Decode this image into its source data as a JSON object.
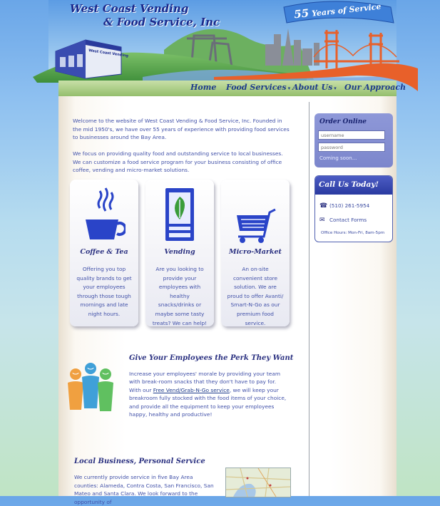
{
  "header": {
    "logo_line1": "West Coast Vending",
    "logo_line2": "& Food Service, Inc",
    "ribbon_number": "55",
    "ribbon_text": "Years of Service",
    "building_sign": "West Coast Vending"
  },
  "nav": {
    "items": [
      {
        "label": "Home",
        "dropdown": false
      },
      {
        "label": "Food Services",
        "dropdown": true
      },
      {
        "label": "About Us",
        "dropdown": true
      },
      {
        "label": "Our Approach",
        "dropdown": false
      }
    ],
    "caret": "▾"
  },
  "intro": {
    "paragraph1": "Welcome to the website of West Coast Vending & Food Service, Inc. Founded in the mid 1950's, we have over 55 years of experience with providing food services to businesses around the Bay Area.",
    "paragraph2": "We focus on providing quality food and outstanding service to local businesses. We can customize a food service program for your business consisting of office coffee, vending and micro-market solutions."
  },
  "cards": [
    {
      "icon": "coffee-cup-icon",
      "title": "Coffee & Tea",
      "text": "Offering you top quality brands to get your employees through those tough mornings and late night hours."
    },
    {
      "icon": "vending-machine-icon",
      "title": "Vending",
      "text": "Are you looking to provide your employees with healthy snacks/drinks or maybe some tasty treats? We can help!"
    },
    {
      "icon": "shopping-cart-icon",
      "title": "Micro-Market",
      "text": "An on-site convenient store solution. We are proud to offer Avanti/ Smart-N-Go as our premium food service."
    }
  ],
  "perk": {
    "title": "Give Your Employees the Perk They Want",
    "text_before": "Increase your employees' morale by providing your team with break-room snacks that they don't have to pay for. With our ",
    "link": "Free Vend/Grab-N-Go service",
    "text_after": ", we will keep your breakroom fully stocked with the food items of your choice, and provide all the equipment to keep your employees happy, healthy and productive!"
  },
  "local": {
    "title": "Local Business, Personal Service",
    "text": "We currently provide service in five Bay Area counties: Alameda, Contra Costa, San Francisco, San Mateo and Santa Clara. We look forward to the opportunity of"
  },
  "sidebar": {
    "order_title": "Order Online",
    "username_placeholder": "username",
    "password_placeholder": "password",
    "coming_soon": "Coming soon...",
    "call_title": "Call Us Today!",
    "phone": "(510) 261-5954",
    "contact": "Contact Forms",
    "hours": "Office Hours: Mon-Fri, 8am-5pm",
    "phone_icon": "☎",
    "mail_icon": "✉"
  },
  "colors": {
    "brand_blue": "#1a2a8c",
    "nav_green": "#94be6c",
    "sidebar_purple": "#8e98d8",
    "bridge_orange": "#e8602a"
  }
}
